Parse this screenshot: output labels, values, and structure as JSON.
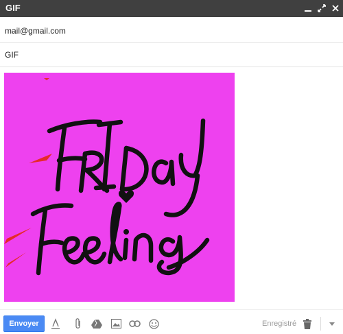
{
  "window": {
    "title": "GIF",
    "controls": [
      "minimize-icon",
      "expand-icon",
      "close-icon"
    ]
  },
  "compose": {
    "to": "mail@gmail.com",
    "subject": "GIF"
  },
  "body": {
    "image": {
      "description_icon": "gif-image",
      "background_color": "#ee41ef"
    }
  },
  "toolbar": {
    "send_label": "Envoyer",
    "saved_status": "Enregistré",
    "icons": [
      "format-text-icon",
      "attach-icon",
      "drive-icon",
      "insert-photo-icon",
      "insert-link-icon",
      "emoji-icon",
      "trash-icon",
      "more-options-icon"
    ],
    "send_color": "#4a8af4"
  }
}
